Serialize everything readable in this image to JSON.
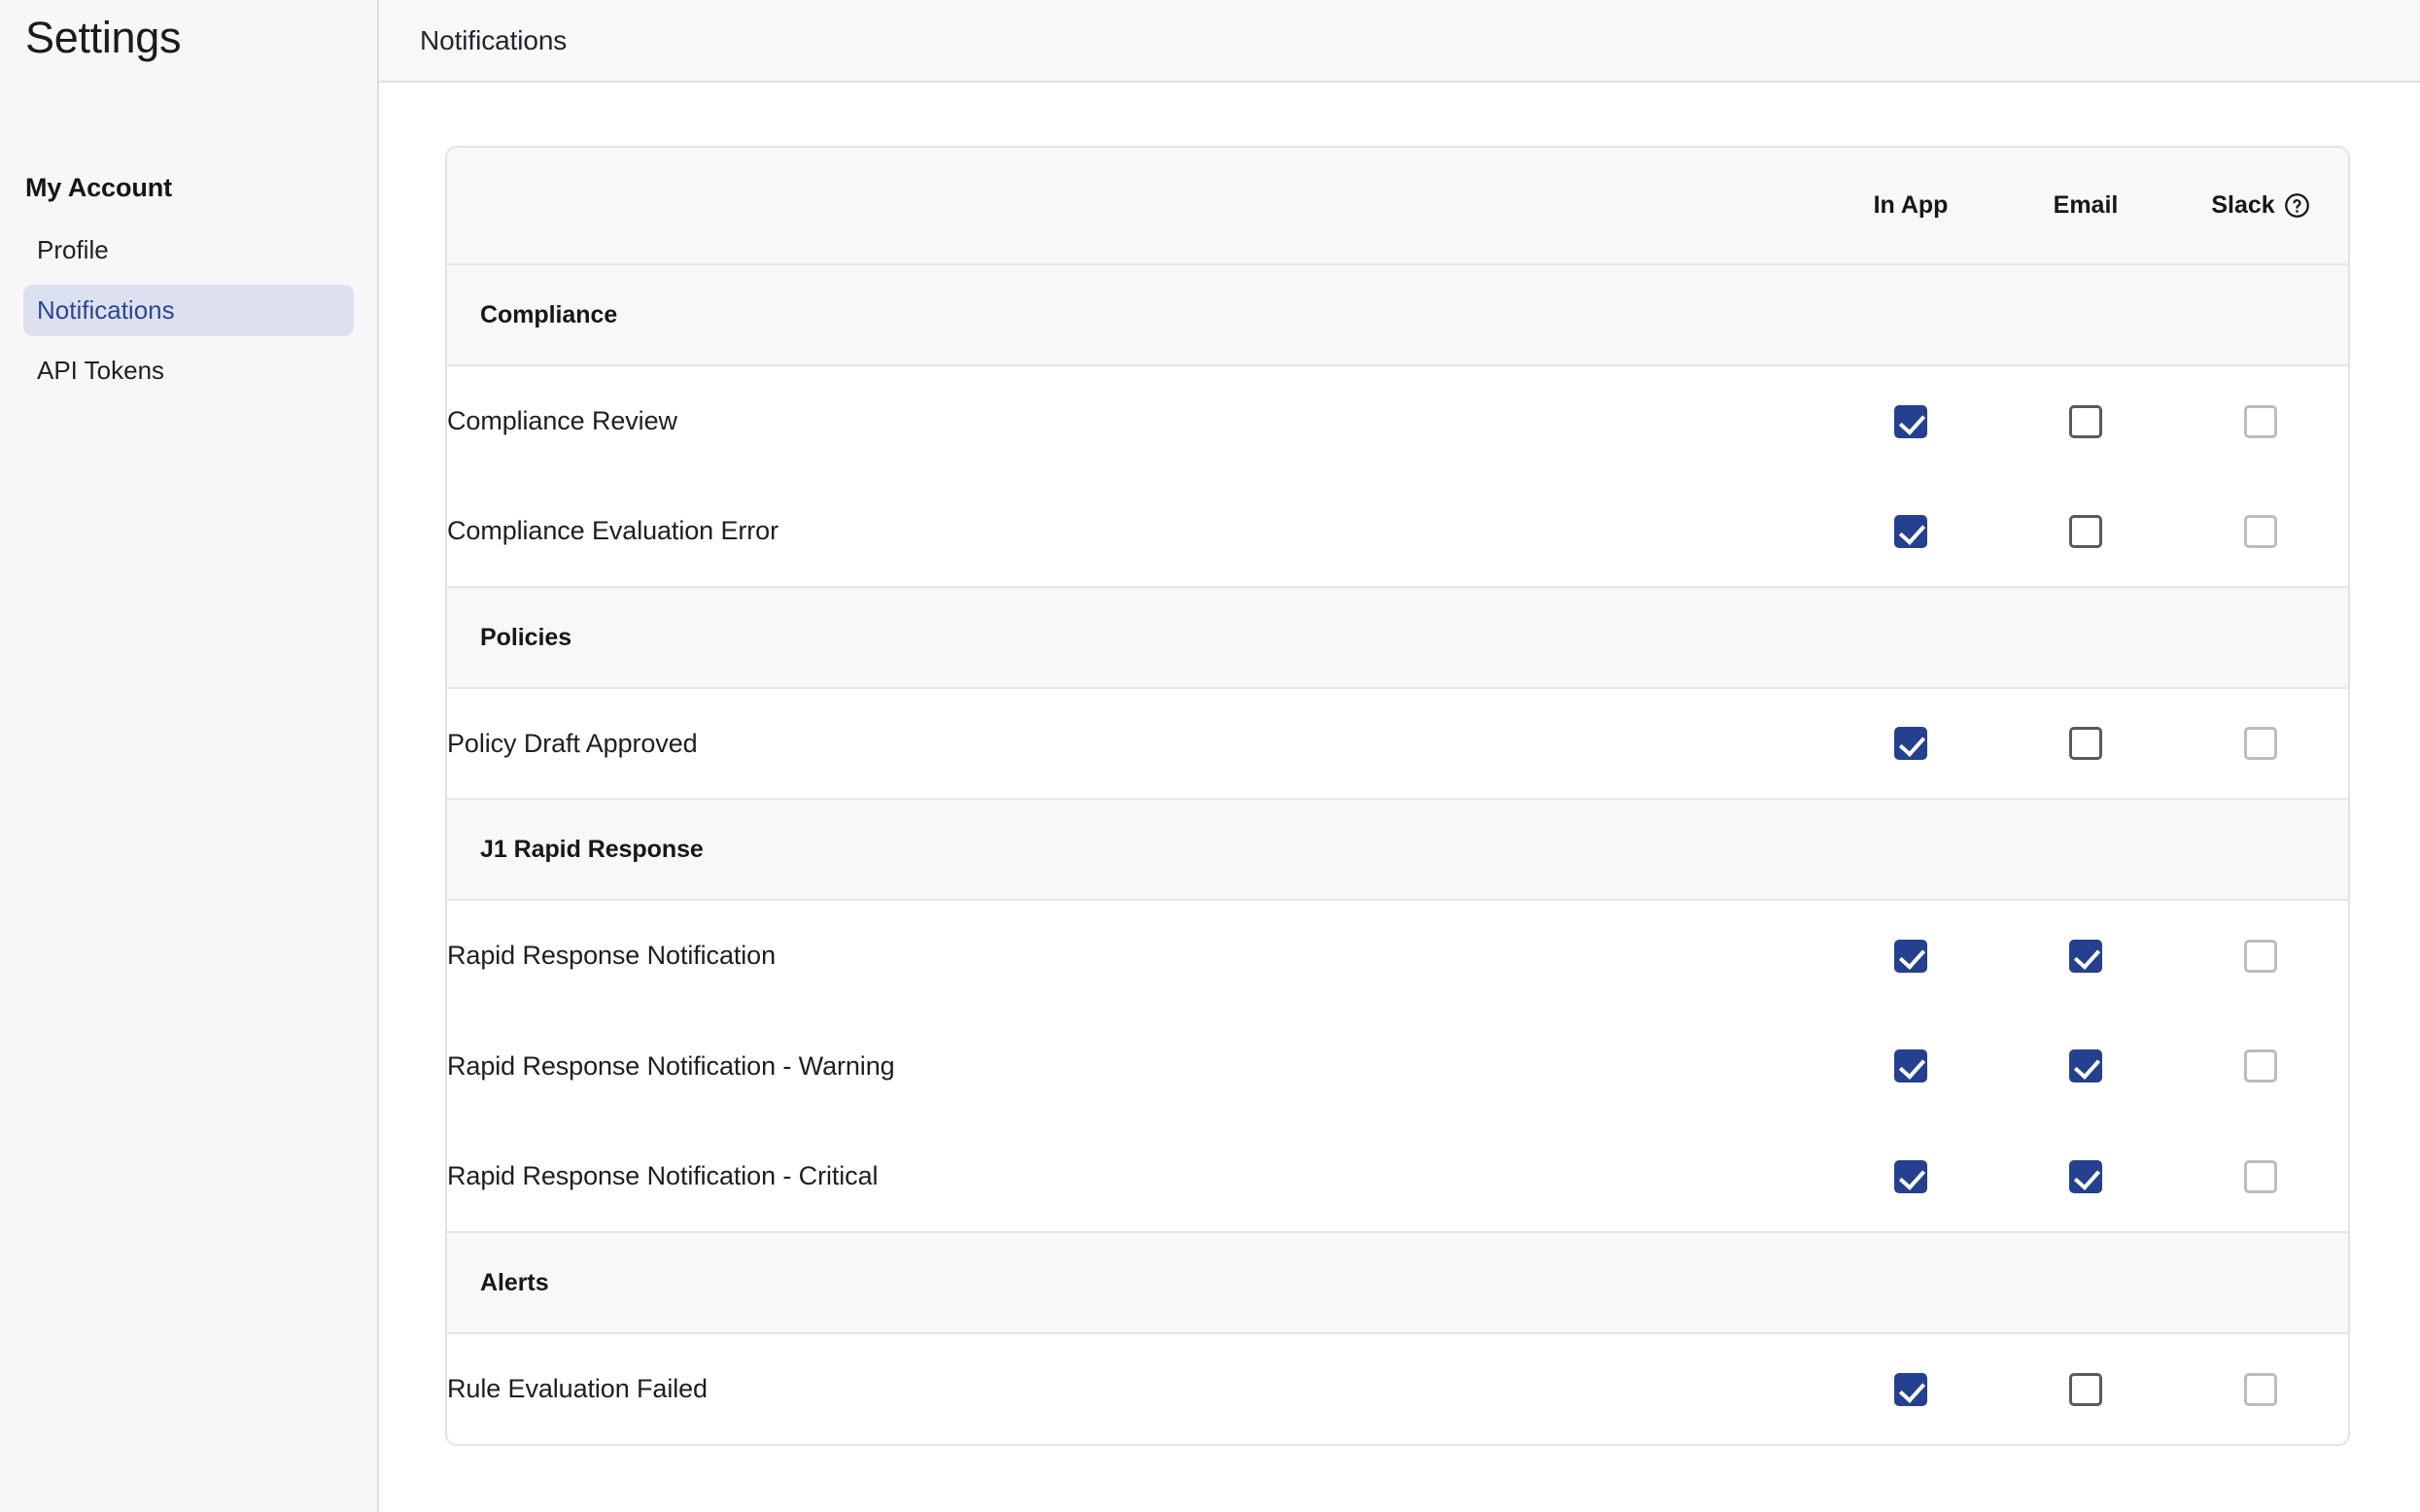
{
  "sidebar": {
    "title": "Settings",
    "section_heading": "My Account",
    "items": [
      {
        "label": "Profile",
        "active": false
      },
      {
        "label": "Notifications",
        "active": true
      },
      {
        "label": "API Tokens",
        "active": false
      }
    ]
  },
  "topbar": {
    "title": "Notifications"
  },
  "table": {
    "name_column_header": "",
    "channels": [
      {
        "label": "In App",
        "help": false
      },
      {
        "label": "Email",
        "help": false
      },
      {
        "label": "Slack",
        "help": true,
        "help_icon": "question-circle-icon"
      }
    ],
    "groups": [
      {
        "title": "Compliance",
        "rows": [
          {
            "label": "Compliance Review",
            "states": [
              "checked",
              "unchecked",
              "disabled"
            ]
          },
          {
            "label": "Compliance Evaluation Error",
            "states": [
              "checked",
              "unchecked",
              "disabled"
            ]
          }
        ]
      },
      {
        "title": "Policies",
        "rows": [
          {
            "label": "Policy Draft Approved",
            "states": [
              "checked",
              "unchecked",
              "disabled"
            ]
          }
        ]
      },
      {
        "title": "J1 Rapid Response",
        "rows": [
          {
            "label": "Rapid Response Notification",
            "states": [
              "checked",
              "checked",
              "disabled"
            ]
          },
          {
            "label": "Rapid Response Notification - Warning",
            "states": [
              "checked",
              "checked",
              "disabled"
            ]
          },
          {
            "label": "Rapid Response Notification - Critical",
            "states": [
              "checked",
              "checked",
              "disabled"
            ]
          }
        ]
      },
      {
        "title": "Alerts",
        "rows": [
          {
            "label": "Rule Evaluation Failed",
            "states": [
              "checked",
              "unchecked",
              "disabled"
            ]
          }
        ]
      }
    ]
  },
  "colors": {
    "accent_blue": "#24408e",
    "active_nav_bg": "#dde1ef",
    "active_nav_text": "#2b4694",
    "header_bg": "#f8f8f9",
    "border": "#e3e3e4",
    "checkbox_enabled_border": "#5a5a5a",
    "checkbox_disabled_border": "#bcbcbc"
  }
}
